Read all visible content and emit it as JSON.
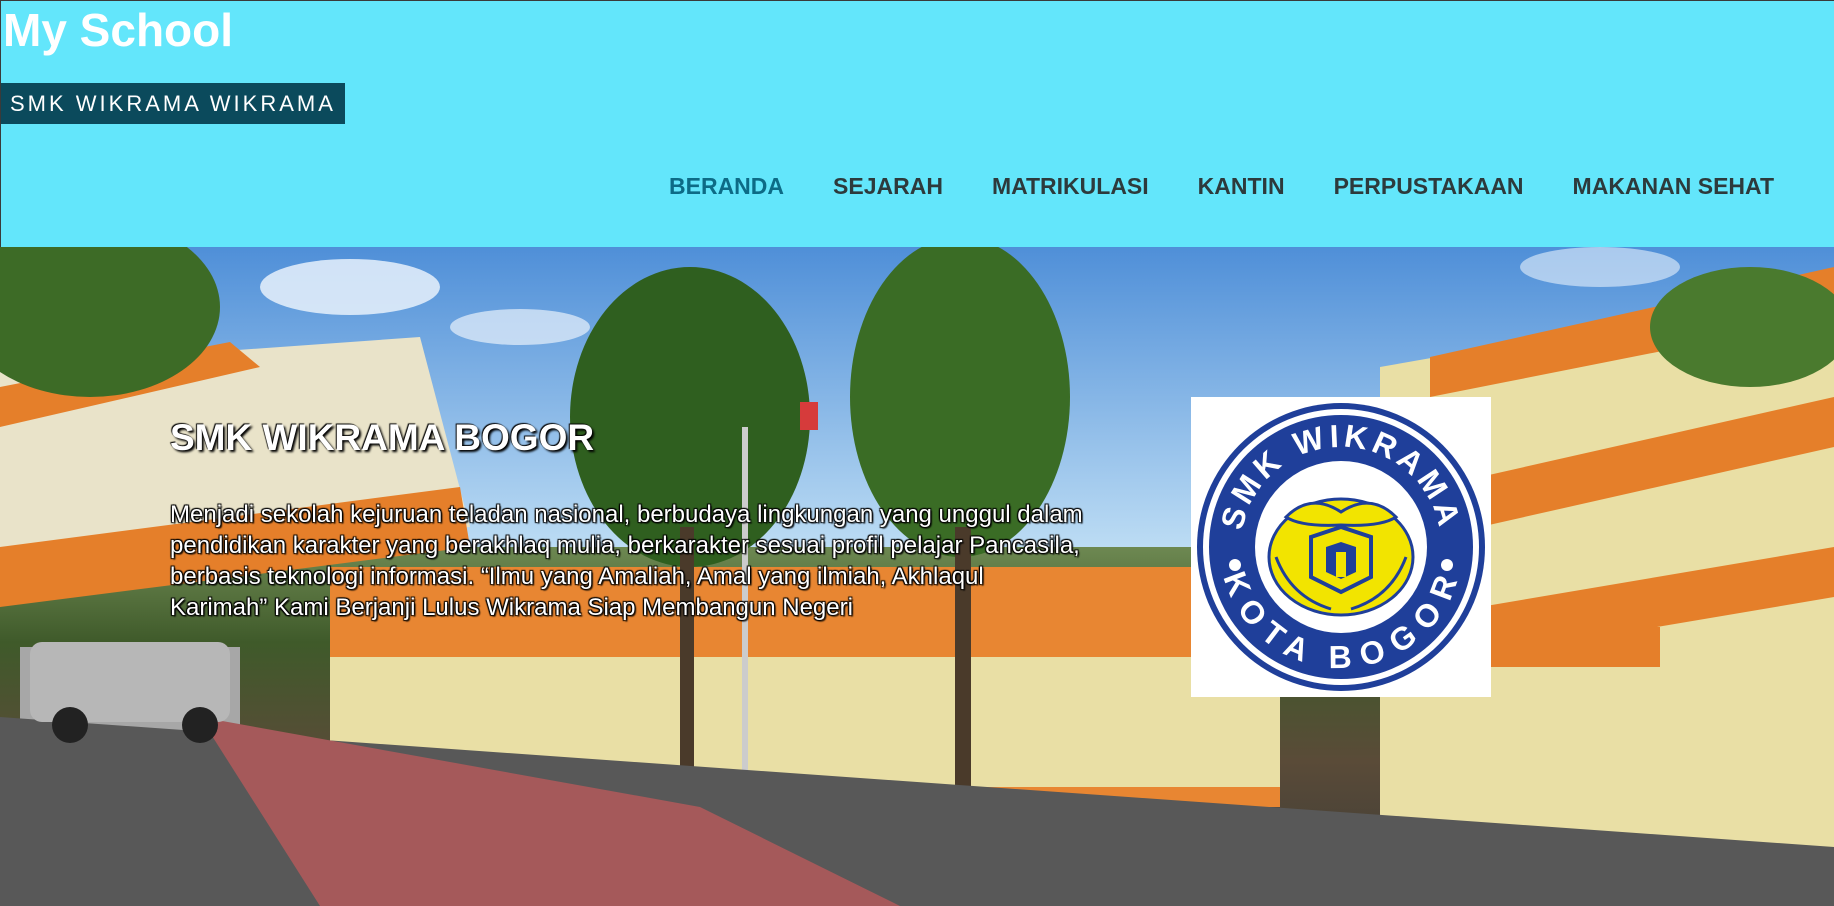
{
  "header": {
    "site_title": "My School",
    "tagline": "SMK WIKRAMA WIKRAMA"
  },
  "nav": {
    "items": [
      {
        "label": "BERANDA",
        "active": true
      },
      {
        "label": "SEJARAH",
        "active": false
      },
      {
        "label": "MATRIKULASI",
        "active": false
      },
      {
        "label": "KANTIN",
        "active": false
      },
      {
        "label": "PERPUSTAKAAN",
        "active": false
      },
      {
        "label": "MAKANAN SEHAT",
        "active": false
      }
    ]
  },
  "hero": {
    "heading": "SMK WIKRAMA BOGOR",
    "description": "Menjadi sekolah kejuruan teladan nasional, berbudaya lingkungan yang unggul dalam pendidikan karakter yang berakhlaq mulia, berkarakter sesuai profil pelajar Pancasila, berbasis teknologi informasi. “Ilmu yang Amaliah, Amal yang ilmiah, Akhlaqul Karimah” Kami Berjanji Lulus Wikrama Siap Membangun Negeri",
    "logo": {
      "top_text": "SMK WIKRAMA",
      "bottom_text": "KOTA BOGOR"
    }
  },
  "colors": {
    "header_bg": "#63e6fb",
    "tagline_bg": "#0b4a5c",
    "nav_active": "#0d6b86",
    "nav_text": "#2d3a3c",
    "logo_blue": "#1f3f9a",
    "logo_yellow": "#f2e400"
  }
}
